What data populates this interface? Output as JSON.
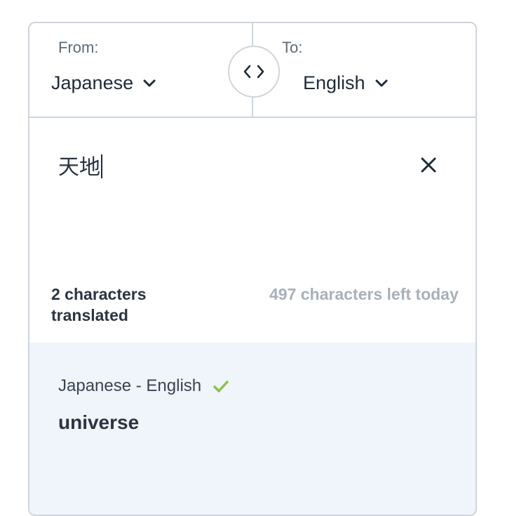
{
  "language_bar": {
    "from_label": "From:",
    "from_value": "Japanese",
    "to_label": "To:",
    "to_value": "English"
  },
  "input": {
    "text": "天地"
  },
  "counts": {
    "translated": "2 characters translated",
    "remaining": "497 characters left today"
  },
  "result": {
    "pair": "Japanese - English",
    "translation": "universe"
  },
  "colors": {
    "border": "#cfd5dd",
    "result_bg": "#f0f4fb",
    "check": "#8bc34a",
    "muted": "#a9b0ba"
  }
}
